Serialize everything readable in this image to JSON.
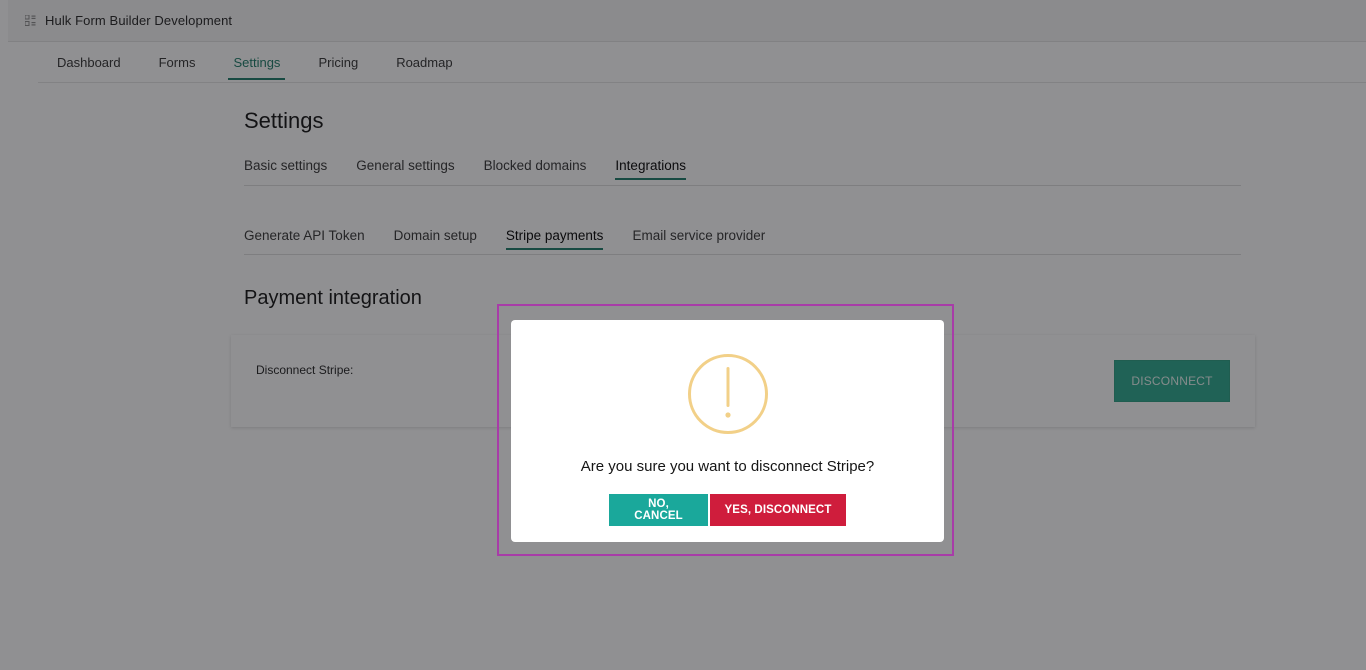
{
  "window": {
    "title": "Hulk Form Builder Development",
    "icon": "app-grid-icon"
  },
  "topnav": {
    "items": [
      {
        "label": "Dashboard"
      },
      {
        "label": "Forms"
      },
      {
        "label": "Settings"
      },
      {
        "label": "Pricing"
      },
      {
        "label": "Roadmap"
      }
    ],
    "active": "Settings"
  },
  "settings": {
    "title": "Settings",
    "tabs": [
      {
        "label": "Basic settings"
      },
      {
        "label": "General settings"
      },
      {
        "label": "Blocked domains"
      },
      {
        "label": "Integrations"
      }
    ],
    "active_tab": "Integrations"
  },
  "integrations": {
    "subtabs": [
      {
        "label": "Generate API Token"
      },
      {
        "label": "Domain setup"
      },
      {
        "label": "Stripe payments"
      },
      {
        "label": "Email service provider"
      }
    ],
    "active_subtab": "Stripe payments"
  },
  "payment": {
    "section_title": "Payment integration",
    "disconnect_label": "Disconnect Stripe:",
    "disconnect_button": "DISCONNECT"
  },
  "modal": {
    "icon": "warning-exclamation-icon",
    "question": "Are you sure you want to disconnect Stripe?",
    "cancel_label": "NO, CANCEL",
    "confirm_label": "YES, DISCONNECT"
  },
  "colors": {
    "accent": "#1a7a66",
    "cancel": "#1aa89b",
    "confirm": "#cf1d3c",
    "warning": "#f2d088",
    "focus_ring": "#a83ca8"
  }
}
